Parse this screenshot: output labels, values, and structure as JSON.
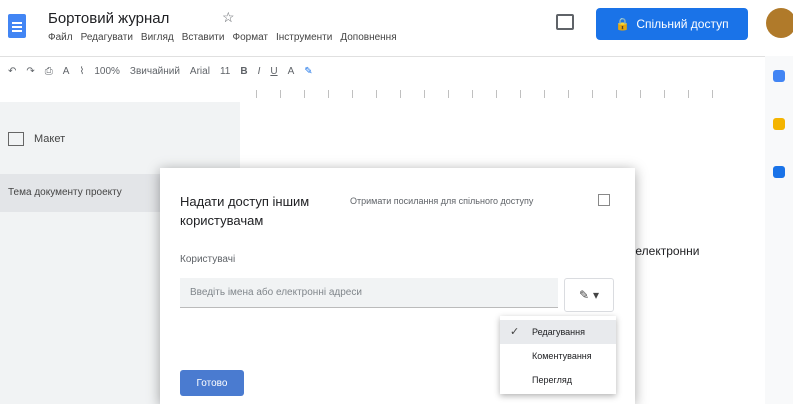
{
  "app": {
    "title": "Бортовий журнал",
    "menu": [
      "Файл",
      "Редагувати",
      "Вигляд",
      "Вставити",
      "Формат",
      "Інструменти",
      "Доповнення"
    ],
    "share_label": "Спільний доступ"
  },
  "toolbar": {
    "zoom": "100%",
    "style": "Звичайний",
    "font": "Arial",
    "size": "11"
  },
  "outline": {
    "button_label": "Макет",
    "item": "Тема документу проекту"
  },
  "page": {
    "visible_text": "та електронни"
  },
  "dialog": {
    "title": "Надати доступ іншим користувачам",
    "note": "Отримати посилання для спільного доступу",
    "field_label": "Користувачі",
    "input_placeholder": "Введіть імена або електронні адреси",
    "send_label": "Готово"
  },
  "access_menu": {
    "selected": "Редагування",
    "items": [
      "Редагування",
      "Коментування",
      "Перегляд"
    ]
  },
  "colors": {
    "accent": "#1a73e8",
    "send_button": "#4a7bd0"
  }
}
